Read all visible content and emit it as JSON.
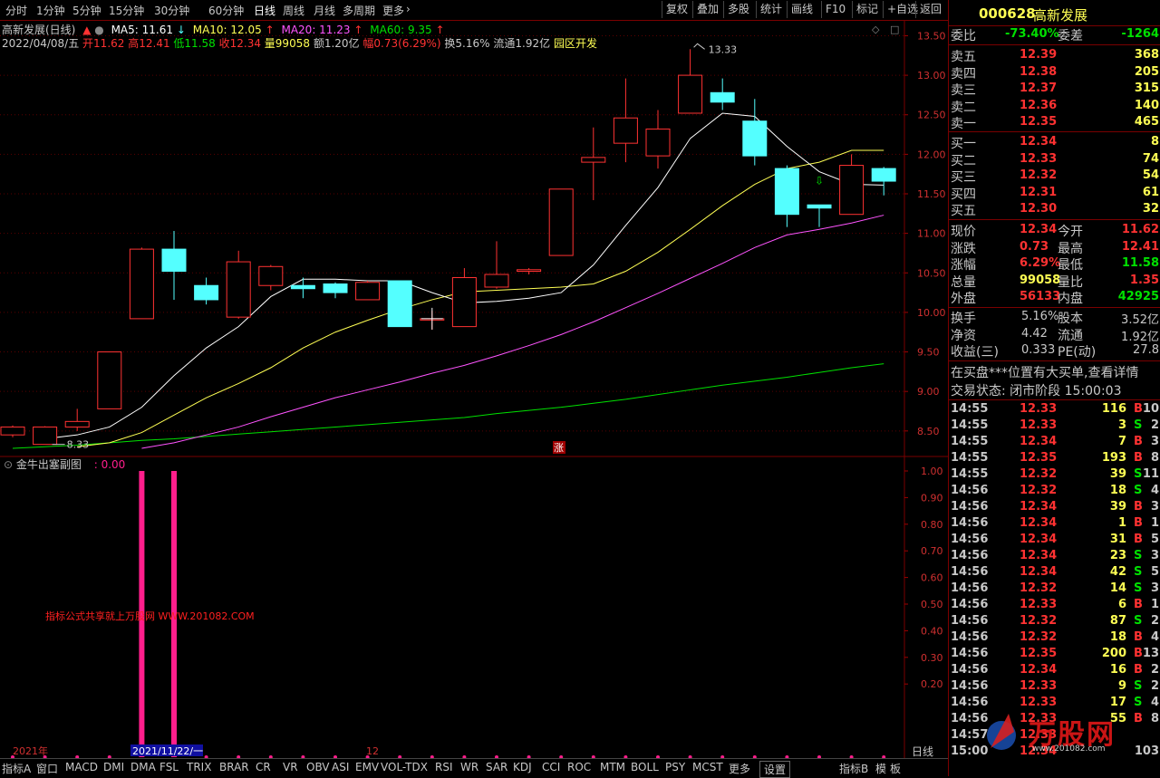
{
  "toolbar": {
    "periods": [
      "分时",
      "1分钟",
      "5分钟",
      "15分钟",
      "30分钟",
      "60分钟",
      "日线",
      "周线",
      "月线",
      "多周期",
      "更多"
    ],
    "selected": "日线",
    "right_buttons": [
      "复权",
      "叠加",
      "多股",
      "统计",
      "画线",
      "F10",
      "标记",
      "+自选",
      "返回"
    ]
  },
  "header": {
    "title": "高新发展(日线)",
    "ma5": "MA5: 11.61",
    "ma10": "MA10: 12.05",
    "ma20": "MA20: 11.23",
    "ma60": "MA60: 9.35",
    "date": "2022/04/08/五",
    "open": "开11.62",
    "high": "高12.41",
    "low": "低11.58",
    "close": "收12.34",
    "volume": "量99058",
    "amount": "额1.20亿",
    "change": "幅0.73(6.29%)",
    "turnover": "换5.16%",
    "float": "流通1.92亿",
    "sector": "园区开发"
  },
  "main_chart": {
    "y_ticks": [
      "13.50",
      "13.00",
      "12.50",
      "12.00",
      "11.50",
      "11.00",
      "10.50",
      "10.00",
      "9.50",
      "9.00",
      "8.50"
    ],
    "high_annot": "13.33",
    "low_annot": "8.33",
    "zhang_label": "涨"
  },
  "sub_chart": {
    "title": "金牛出塞副图",
    "value": ": 0.00",
    "y_ticks": [
      "1.00",
      "0.90",
      "0.80",
      "0.70",
      "0.60",
      "0.50",
      "0.40",
      "0.30",
      "0.20"
    ],
    "watermark": "指标公式共享就上万股网 WWW.201082.COM"
  },
  "x_axis": {
    "labels": [
      "2021年",
      "2021/11/22/一",
      "12"
    ],
    "period": "日线"
  },
  "bottom_tabs": [
    "指标A",
    "窗口",
    "MACD",
    "DMI",
    "DMA",
    "FSL",
    "TRIX",
    "BRAR",
    "CR",
    "VR",
    "OBV",
    "ASI",
    "EMV",
    "VOL-TDX",
    "RSI",
    "WR",
    "SAR",
    "KDJ",
    "CCI",
    "ROC",
    "MTM",
    "BOLL",
    "PSY",
    "MCST",
    "更多",
    "设置",
    "指标B",
    "模",
    "板"
  ],
  "stock": {
    "code": "000628",
    "name": "高新发展",
    "weibi_label": "委比",
    "weibi": "-73.40%",
    "weicha_label": "委差",
    "weicha": "-1264",
    "asks": [
      {
        "label": "卖五",
        "price": "12.39",
        "vol": "368"
      },
      {
        "label": "卖四",
        "price": "12.38",
        "vol": "205"
      },
      {
        "label": "卖三",
        "price": "12.37",
        "vol": "315"
      },
      {
        "label": "卖二",
        "price": "12.36",
        "vol": "140"
      },
      {
        "label": "卖一",
        "price": "12.35",
        "vol": "465"
      }
    ],
    "bids": [
      {
        "label": "买一",
        "price": "12.34",
        "vol": "8"
      },
      {
        "label": "买二",
        "price": "12.33",
        "vol": "74"
      },
      {
        "label": "买三",
        "price": "12.32",
        "vol": "54"
      },
      {
        "label": "买四",
        "price": "12.31",
        "vol": "61"
      },
      {
        "label": "买五",
        "price": "12.30",
        "vol": "32"
      }
    ],
    "quote": [
      {
        "l1": "现价",
        "v1": "12.34",
        "l2": "今开",
        "v2": "11.62"
      },
      {
        "l1": "涨跌",
        "v1": "0.73",
        "l2": "最高",
        "v2": "12.41"
      },
      {
        "l1": "涨幅",
        "v1": "6.29%",
        "l2": "最低",
        "v2": "11.58"
      },
      {
        "l1": "总量",
        "v1": "99058",
        "l2": "量比",
        "v2": "1.35"
      },
      {
        "l1": "外盘",
        "v1": "56133",
        "l2": "内盘",
        "v2": "42925"
      }
    ],
    "stats": [
      {
        "l1": "换手",
        "v1": "5.16%",
        "l2": "股本",
        "v2": "3.52亿"
      },
      {
        "l1": "净资",
        "v1": "4.42",
        "l2": "流通",
        "v2": "1.92亿"
      },
      {
        "l1": "收益(三)",
        "v1": "0.333",
        "l2": "PE(动)",
        "v2": "27.8"
      }
    ],
    "notice": "在买盘***位置有大买单,查看详情",
    "trade_status": "交易状态: 闭市阶段 15:00:03",
    "ticks": [
      {
        "t": "14:55",
        "p": "12.33",
        "v": "116",
        "d": "B",
        "n": "10"
      },
      {
        "t": "14:55",
        "p": "12.33",
        "v": "3",
        "d": "S",
        "n": "2"
      },
      {
        "t": "14:55",
        "p": "12.34",
        "v": "7",
        "d": "B",
        "n": "3"
      },
      {
        "t": "14:55",
        "p": "12.35",
        "v": "193",
        "d": "B",
        "n": "8"
      },
      {
        "t": "14:55",
        "p": "12.32",
        "v": "39",
        "d": "S",
        "n": "11"
      },
      {
        "t": "14:56",
        "p": "12.32",
        "v": "18",
        "d": "S",
        "n": "4"
      },
      {
        "t": "14:56",
        "p": "12.34",
        "v": "39",
        "d": "B",
        "n": "3"
      },
      {
        "t": "14:56",
        "p": "12.34",
        "v": "1",
        "d": "B",
        "n": "1"
      },
      {
        "t": "14:56",
        "p": "12.34",
        "v": "31",
        "d": "B",
        "n": "5"
      },
      {
        "t": "14:56",
        "p": "12.34",
        "v": "23",
        "d": "S",
        "n": "3"
      },
      {
        "t": "14:56",
        "p": "12.34",
        "v": "42",
        "d": "S",
        "n": "5"
      },
      {
        "t": "14:56",
        "p": "12.32",
        "v": "14",
        "d": "S",
        "n": "3"
      },
      {
        "t": "14:56",
        "p": "12.33",
        "v": "6",
        "d": "B",
        "n": "1"
      },
      {
        "t": "14:56",
        "p": "12.32",
        "v": "87",
        "d": "S",
        "n": "2"
      },
      {
        "t": "14:56",
        "p": "12.32",
        "v": "18",
        "d": "B",
        "n": "4"
      },
      {
        "t": "14:56",
        "p": "12.35",
        "v": "200",
        "d": "B",
        "n": "13"
      },
      {
        "t": "14:56",
        "p": "12.34",
        "v": "16",
        "d": "B",
        "n": "2"
      },
      {
        "t": "14:56",
        "p": "12.33",
        "v": "9",
        "d": "S",
        "n": "2"
      },
      {
        "t": "14:56",
        "p": "12.33",
        "v": "17",
        "d": "S",
        "n": "4"
      },
      {
        "t": "14:56",
        "p": "12.33",
        "v": "55",
        "d": "B",
        "n": "8"
      },
      {
        "t": "14:57",
        "p": "12.33",
        "v": "",
        "d": "",
        "n": ""
      },
      {
        "t": "15:00",
        "p": "12.34",
        "v": "",
        "d": "",
        "n": "103"
      }
    ],
    "logo_text": "万股网",
    "logo_url": "www.201082.com"
  },
  "chart_data": {
    "type": "candlestick",
    "ylim": [
      8.2,
      13.7
    ],
    "candles": [
      {
        "o": 8.45,
        "c": 8.55,
        "h": 8.57,
        "l": 8.42
      },
      {
        "o": 8.33,
        "c": 8.55,
        "h": 8.56,
        "l": 8.33
      },
      {
        "o": 8.55,
        "c": 8.62,
        "h": 8.78,
        "l": 8.5
      },
      {
        "o": 8.78,
        "c": 9.5,
        "h": 9.5,
        "l": 8.78
      },
      {
        "o": 9.92,
        "c": 10.8,
        "h": 10.82,
        "l": 9.92
      },
      {
        "o": 10.8,
        "c": 10.52,
        "h": 11.03,
        "l": 10.16
      },
      {
        "o": 10.34,
        "c": 10.16,
        "h": 10.44,
        "l": 10.1
      },
      {
        "o": 9.94,
        "c": 10.64,
        "h": 10.78,
        "l": 9.92
      },
      {
        "o": 10.34,
        "c": 10.58,
        "h": 10.6,
        "l": 10.28
      },
      {
        "o": 10.34,
        "c": 10.3,
        "h": 10.44,
        "l": 10.18
      },
      {
        "o": 10.36,
        "c": 10.25,
        "h": 10.38,
        "l": 10.18
      },
      {
        "o": 10.16,
        "c": 10.38,
        "h": 10.4,
        "l": 10.16
      },
      {
        "o": 10.4,
        "c": 9.82,
        "h": 10.4,
        "l": 9.82
      },
      {
        "o": 9.92,
        "c": 9.92,
        "h": 10.02,
        "l": 9.78
      },
      {
        "o": 9.82,
        "c": 10.44,
        "h": 10.56,
        "l": 9.82
      },
      {
        "o": 10.32,
        "c": 10.48,
        "h": 10.9,
        "l": 10.3
      },
      {
        "o": 10.52,
        "c": 10.54,
        "h": 10.56,
        "l": 10.48
      },
      {
        "o": 10.72,
        "c": 11.56,
        "h": 11.56,
        "l": 10.72
      },
      {
        "o": 11.9,
        "c": 11.96,
        "h": 12.34,
        "l": 11.42
      },
      {
        "o": 12.14,
        "c": 12.46,
        "h": 12.96,
        "l": 11.9
      },
      {
        "o": 11.98,
        "c": 12.32,
        "h": 12.56,
        "l": 11.82
      },
      {
        "o": 12.52,
        "c": 13.0,
        "h": 13.33,
        "l": 12.52
      },
      {
        "o": 12.78,
        "c": 12.66,
        "h": 12.96,
        "l": 12.56
      },
      {
        "o": 12.42,
        "c": 11.98,
        "h": 12.7,
        "l": 11.86
      },
      {
        "o": 11.82,
        "c": 11.24,
        "h": 11.86,
        "l": 11.08
      },
      {
        "o": 11.36,
        "c": 11.32,
        "h": 11.36,
        "l": 11.08
      },
      {
        "o": 11.24,
        "c": 11.86,
        "h": 12.0,
        "l": 11.24
      },
      {
        "o": 11.82,
        "c": 11.66,
        "h": 11.84,
        "l": 11.48
      }
    ],
    "ma5": [
      null,
      8.4,
      8.45,
      8.55,
      8.8,
      9.2,
      9.55,
      9.82,
      10.2,
      10.42,
      10.42,
      10.4,
      10.4,
      10.25,
      10.12,
      10.14,
      10.18,
      10.25,
      10.6,
      11.1,
      11.58,
      12.2,
      12.52,
      12.48,
      12.1,
      11.78,
      11.62,
      11.61
    ],
    "ma10": [
      null,
      null,
      8.3,
      8.35,
      8.48,
      8.7,
      8.92,
      9.1,
      9.3,
      9.55,
      9.75,
      9.9,
      10.04,
      10.16,
      10.26,
      10.28,
      10.3,
      10.32,
      10.36,
      10.52,
      10.76,
      11.05,
      11.35,
      11.62,
      11.82,
      11.9,
      12.05,
      12.05
    ],
    "ma20": [
      null,
      null,
      null,
      null,
      8.28,
      8.35,
      8.45,
      8.55,
      8.68,
      8.8,
      8.92,
      9.02,
      9.12,
      9.23,
      9.33,
      9.45,
      9.58,
      9.72,
      9.88,
      10.06,
      10.24,
      10.43,
      10.62,
      10.82,
      10.98,
      11.05,
      11.13,
      11.23
    ],
    "ma60": [
      8.28,
      8.3,
      8.32,
      8.35,
      8.38,
      8.4,
      8.43,
      8.46,
      8.49,
      8.52,
      8.55,
      8.58,
      8.61,
      8.64,
      8.67,
      8.72,
      8.76,
      8.8,
      8.85,
      8.9,
      8.96,
      9.02,
      9.08,
      9.13,
      9.18,
      9.24,
      9.3,
      9.35
    ],
    "signal": [
      0,
      0,
      0,
      0,
      1,
      1,
      0,
      0,
      0,
      0,
      0,
      0,
      0,
      0,
      0,
      0,
      0,
      0,
      0,
      0,
      0,
      0,
      0,
      0,
      0,
      0,
      0,
      0
    ],
    "colors": {
      "up": "#ff3232",
      "down": "#54ffff",
      "ma5": "#ffffff",
      "ma10": "#ffff54",
      "ma20": "#ff54ff",
      "ma60": "#00e000",
      "signal": "#ff1e8c"
    }
  }
}
